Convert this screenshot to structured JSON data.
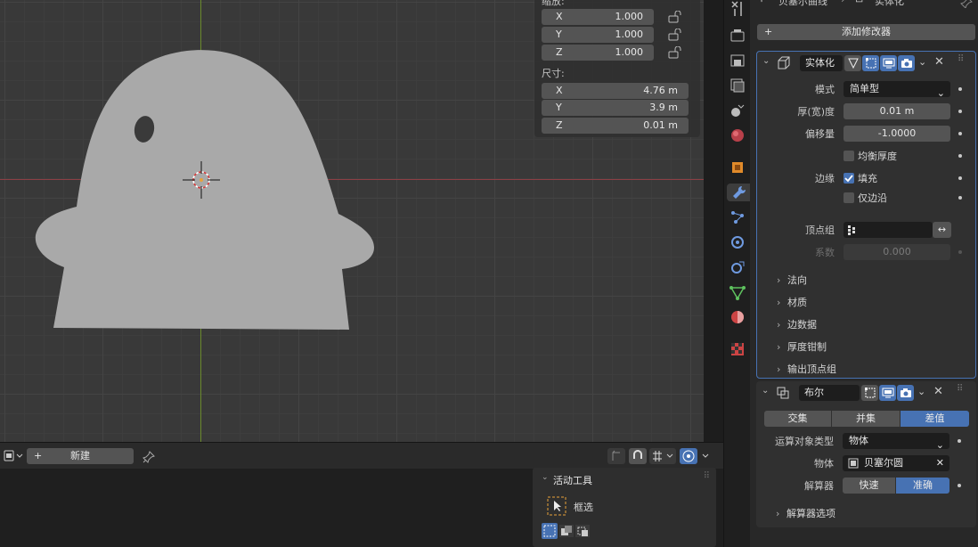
{
  "viewport": {
    "npanel": {
      "scale_label": "缩放:",
      "scale": [
        {
          "axis": "X",
          "value": "1.000"
        },
        {
          "axis": "Y",
          "value": "1.000"
        },
        {
          "axis": "Z",
          "value": "1.000"
        }
      ],
      "dims_label": "尺寸:",
      "dims": [
        {
          "axis": "X",
          "value": "4.76 m"
        },
        {
          "axis": "Y",
          "value": "3.9 m"
        },
        {
          "axis": "Z",
          "value": "0.01 m"
        }
      ]
    }
  },
  "bottom": {
    "new_label": "新建",
    "tool_panel": {
      "title": "活动工具",
      "tool": "框选"
    }
  },
  "props": {
    "crumb": {
      "object": "贝塞尔曲线",
      "data": "实体化"
    },
    "add_modifier": "添加修改器",
    "solidify": {
      "name": "实体化",
      "mode_label": "模式",
      "mode_value": "简单型",
      "thickness_label": "厚(宽)度",
      "thickness_value": "0.01 m",
      "offset_label": "偏移量",
      "offset_value": "-1.0000",
      "even_label": "均衡厚度",
      "rim_label": "边缘",
      "fill_label": "填充",
      "rim_only_label": "仅边沿",
      "vgroup_label": "顶点组",
      "factor_label": "系数",
      "factor_value": "0.000",
      "subpanels": [
        "法向",
        "材质",
        "边数据",
        "厚度钳制",
        "输出顶点组"
      ]
    },
    "boolean": {
      "name": "布尔",
      "ops": [
        "交集",
        "并集",
        "差值"
      ],
      "operand_label": "运算对象类型",
      "operand_value": "物体",
      "object_label": "物体",
      "object_value": "贝塞尔圆",
      "solver_label": "解算器",
      "solver_fast": "快速",
      "solver_exact": "准确",
      "solver_options": "解算器选项"
    }
  },
  "colors": {
    "accent": "#4772b3",
    "x_axis": "#8c3f45",
    "y_axis": "#6a8a2c",
    "mesh": "#a9a9a9"
  }
}
